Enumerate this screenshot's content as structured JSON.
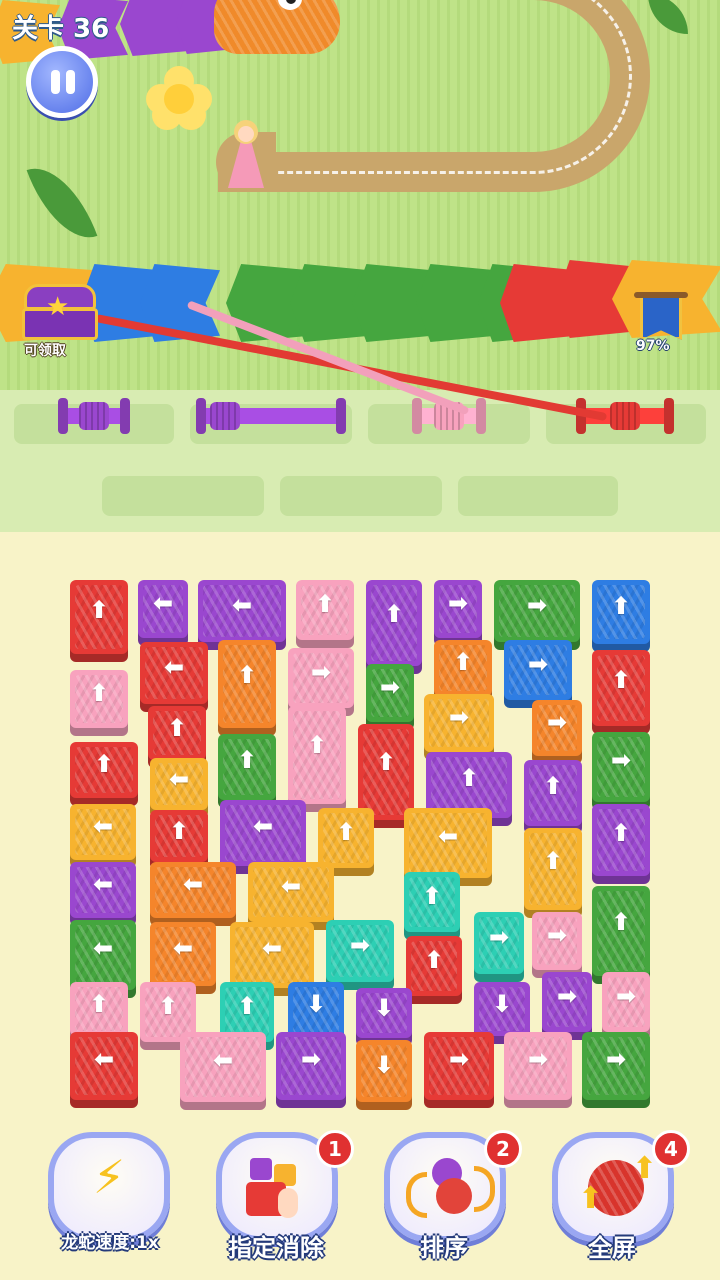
{
  "hud": {
    "level_label": "关卡 36"
  },
  "rewards": {
    "chest_label": "可领取",
    "progress_label": "97%"
  },
  "colors": {
    "red": "#e63a36",
    "purple": "#9a47cf",
    "pink": "#f8a2be",
    "orange": "#f5852b",
    "yellow": "#f7b32f",
    "green": "#45a63f",
    "blue": "#2e7de3",
    "teal": "#2dcfb4"
  },
  "spools": [
    {
      "color": "purple",
      "filled": true
    },
    {
      "color": "purple",
      "filled": true
    },
    {
      "color": "pink",
      "filled": true
    },
    {
      "color": "red",
      "filled": true
    },
    {
      "color": "",
      "filled": false
    },
    {
      "color": "",
      "filled": false
    },
    {
      "color": "",
      "filled": false
    }
  ],
  "dragon_segments": [
    "yellow",
    "blue",
    "blue",
    "green",
    "green",
    "green",
    "green",
    "green",
    "red",
    "red",
    "yellow"
  ],
  "tiles": [
    {
      "c": "red",
      "d": "up"
    },
    {
      "c": "purple",
      "d": "left"
    },
    {
      "c": "purple",
      "d": "left"
    },
    {
      "c": "pink",
      "d": "up"
    },
    {
      "c": "purple",
      "d": "up"
    },
    {
      "c": "purple",
      "d": "right"
    },
    {
      "c": "green",
      "d": "right"
    },
    {
      "c": "blue",
      "d": "up"
    },
    {
      "c": "red",
      "d": "left"
    },
    {
      "c": "orange",
      "d": "up"
    },
    {
      "c": "pink",
      "d": "right"
    },
    {
      "c": "orange",
      "d": "up"
    },
    {
      "c": "blue",
      "d": "right"
    },
    {
      "c": "red",
      "d": "up"
    },
    {
      "c": "pink",
      "d": "up"
    },
    {
      "c": "green",
      "d": "right"
    },
    {
      "c": "yellow",
      "d": "right"
    },
    {
      "c": "orange",
      "d": "right"
    },
    {
      "c": "red",
      "d": "up"
    },
    {
      "c": "green",
      "d": "up"
    },
    {
      "c": "pink",
      "d": "up"
    },
    {
      "c": "red",
      "d": "up"
    },
    {
      "c": "green",
      "d": "right"
    },
    {
      "c": "red",
      "d": "up"
    },
    {
      "c": "yellow",
      "d": "left"
    },
    {
      "c": "purple",
      "d": "up"
    },
    {
      "c": "purple",
      "d": "up"
    },
    {
      "c": "yellow",
      "d": "left"
    },
    {
      "c": "red",
      "d": "up"
    },
    {
      "c": "purple",
      "d": "left"
    },
    {
      "c": "yellow",
      "d": "up"
    },
    {
      "c": "yellow",
      "d": "left"
    },
    {
      "c": "yellow",
      "d": "up"
    },
    {
      "c": "purple",
      "d": "up"
    },
    {
      "c": "purple",
      "d": "left"
    },
    {
      "c": "orange",
      "d": "left"
    },
    {
      "c": "yellow",
      "d": "left"
    },
    {
      "c": "teal",
      "d": "up"
    },
    {
      "c": "green",
      "d": "up"
    },
    {
      "c": "green",
      "d": "left"
    },
    {
      "c": "orange",
      "d": "left"
    },
    {
      "c": "yellow",
      "d": "left"
    },
    {
      "c": "teal",
      "d": "right"
    },
    {
      "c": "teal",
      "d": "right"
    },
    {
      "c": "pink",
      "d": "right"
    },
    {
      "c": "red",
      "d": "up"
    },
    {
      "c": "pink",
      "d": "up"
    },
    {
      "c": "pink",
      "d": "up"
    },
    {
      "c": "teal",
      "d": "up"
    },
    {
      "c": "blue",
      "d": "down"
    },
    {
      "c": "purple",
      "d": "down"
    },
    {
      "c": "purple",
      "d": "down"
    },
    {
      "c": "purple",
      "d": "right"
    },
    {
      "c": "pink",
      "d": "right"
    },
    {
      "c": "red",
      "d": "left"
    },
    {
      "c": "pink",
      "d": "left"
    },
    {
      "c": "purple",
      "d": "right"
    },
    {
      "c": "orange",
      "d": "down"
    },
    {
      "c": "red",
      "d": "right"
    },
    {
      "c": "pink",
      "d": "right"
    },
    {
      "c": "green",
      "d": "right"
    }
  ],
  "powerups": [
    {
      "label": "龙蛇速度:1x",
      "icon": "lightning-icon",
      "count": ""
    },
    {
      "label": "指定消除",
      "icon": "tap-remove-icon",
      "count": "1"
    },
    {
      "label": "排序",
      "icon": "sort-yarn-icon",
      "count": "2"
    },
    {
      "label": "全屏",
      "icon": "fullscreen-yarn-icon",
      "count": "4"
    }
  ]
}
